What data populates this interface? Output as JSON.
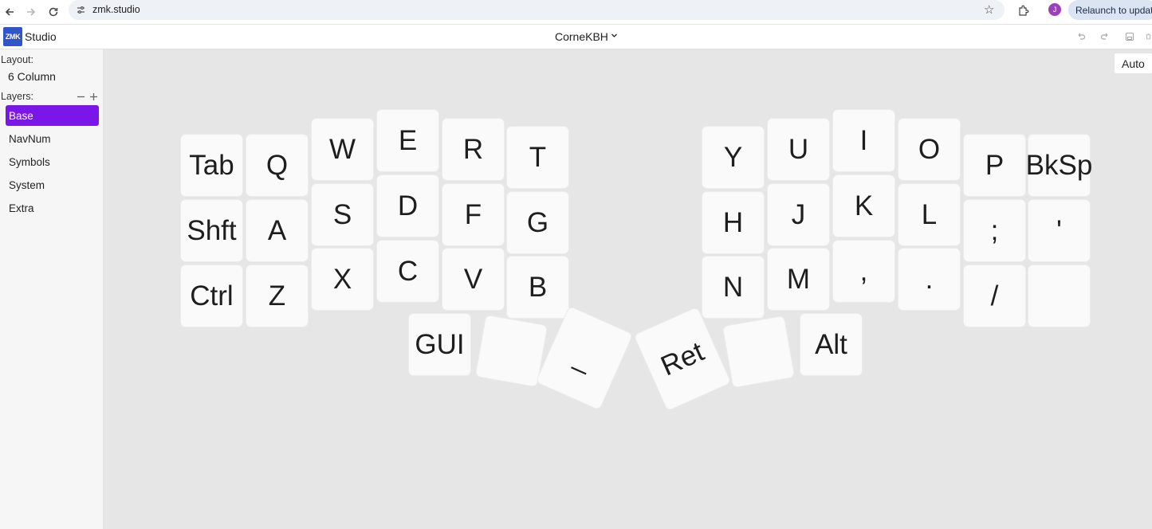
{
  "browser": {
    "url": "zmk.studio",
    "relaunch_label": "Relaunch to update",
    "profile_initial": "J",
    "icons": [
      "back-arrow-icon",
      "forward-arrow-icon",
      "reload-icon",
      "site-settings-icon",
      "bookmark-star-icon",
      "extensions-icon"
    ]
  },
  "app": {
    "logo_text": "ZMK",
    "studio_label": "Studio",
    "keyboard_name": "CorneKBH",
    "header_icons": [
      "undo-icon",
      "redo-icon",
      "save-icon"
    ]
  },
  "sidebar": {
    "layout_heading": "Layout:",
    "layout_value": "6 Column",
    "layers_heading": "Layers:",
    "layers": [
      {
        "label": "Base",
        "active": true
      },
      {
        "label": "NavNum",
        "active": false
      },
      {
        "label": "Symbols",
        "active": false
      },
      {
        "label": "System",
        "active": false
      },
      {
        "label": "Extra",
        "active": false
      }
    ]
  },
  "main": {
    "auto_label": "Auto",
    "keys": [
      "Tab",
      "Q",
      "W",
      "E",
      "R",
      "T",
      "Shft",
      "A",
      "S",
      "D",
      "F",
      "G",
      "Ctrl",
      "Z",
      "X",
      "C",
      "V",
      "B",
      "Y",
      "U",
      "I",
      "O",
      "P",
      "BkSp",
      "H",
      "J",
      "K",
      "L",
      ";",
      "'",
      "N",
      "M",
      ",",
      ".",
      "/",
      "",
      "GUI",
      "",
      "_",
      "Ret",
      "",
      "Alt"
    ]
  },
  "colors": {
    "accent": "#7a16e8",
    "logo": "#2f55c8",
    "canvas": "#e6e6e6"
  }
}
